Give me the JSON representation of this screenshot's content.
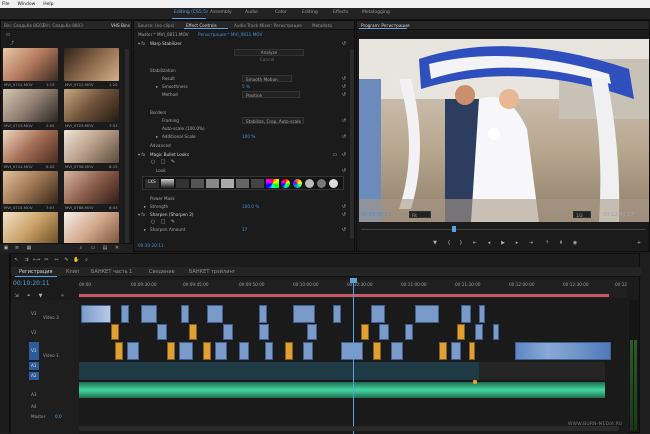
{
  "menu": [
    "File",
    "Window",
    "Help"
  ],
  "workspaces": [
    "Editing (CS5.5)",
    "Assembly",
    "Audio",
    "Color",
    "Editing",
    "Effects",
    "Metalogging"
  ],
  "left_tabs": [
    "Bin: Свадьба 8G02",
    "Bin: Свадьба 8603",
    "VHS Bins"
  ],
  "center_tabs": [
    "Source: (no clips)",
    "Effect Controls",
    "Audio Track Mixer: Регистрация",
    "Metadata"
  ],
  "program": {
    "tab": "Program: Регистрация",
    "timecode": "00:10:20:11",
    "fit": "Fit",
    "ratio": "1/2",
    "duration": "00:12:40:17"
  },
  "bin_clips": [
    "MVI_0712.MOV",
    "MVI_0712.MOV",
    "MVI_0713.MOV",
    "MVI_0723.MOV",
    "MVI_0714.MOV",
    "MVI_0758.MOV",
    "MVI_0715.MOV",
    "MVI_0788.MOV",
    "MVI_0716.MOV",
    "MVI_0798.MOV"
  ],
  "bin_durations": [
    "1:15",
    "1:25",
    "2:05",
    "7:53",
    "6:02",
    "8:15",
    "7:07",
    "6:03",
    "4:06",
    "2:11"
  ],
  "effect_controls": {
    "master": "Master * MVI_0811.MOV",
    "sequence": "Регистрация * MVI_0811.MOV",
    "warp": "Warp Stabilizer",
    "analyze": "Analyze",
    "cancel": "Cancel",
    "stabilization": "Stabilization",
    "result_label": "Result",
    "result_value": "Smooth Motion",
    "smoothness_label": "Smoothness",
    "smoothness_value": "5 %",
    "method_label": "Method",
    "method_value": "Position",
    "borders": "Borders",
    "framing_label": "Framing",
    "framing_value": "Stabilize, Crop, Auto-scale",
    "autoscale": "Auto-scale (100.0%)",
    "additional_label": "Additional Scale",
    "additional_value": "100 %",
    "advanced": "Advanced",
    "magic": "Magic Bullet Looks",
    "look": "Look",
    "power_mask": "Power Mask",
    "strength_label": "Strength",
    "strength_value": "100.0 %",
    "sharpen": "Sharpen (Sharpen 2)",
    "sharpen_amount_label": "Sharpen Amount",
    "sharpen_amount_value": "17",
    "bottom_tc": "00:10:20:11"
  },
  "timeline": {
    "tabs": [
      "Регистрация",
      "Клип",
      "БАНКЕТ часть 1",
      "Сведение",
      "БАНКЕТ трэйлинг"
    ],
    "timecode": "00:10:20:11",
    "ruler": [
      "00:00",
      "00:09:30:00",
      "00:09:45:00",
      "00:09:50:00",
      "00:10:00:00",
      "00:10:30:00",
      "00:11:00:00",
      "00:11:30:00",
      "00:12:00:00",
      "00:12:30:00",
      "00:12"
    ],
    "tracks": [
      "V3",
      "V2",
      "V1",
      "A1",
      "A2",
      "A3",
      "A4",
      "Master"
    ],
    "v3_label": "Video 3",
    "v1_label": "Video 1",
    "master_value": "0.0"
  },
  "watermark": "WWW.BURN-MEDIA.RU",
  "colors": {
    "accent": "#5ba3e0",
    "clip_video": "#7a9bc9",
    "clip_audio_wave": "#3fcf9a",
    "orange": "#e2a030"
  }
}
